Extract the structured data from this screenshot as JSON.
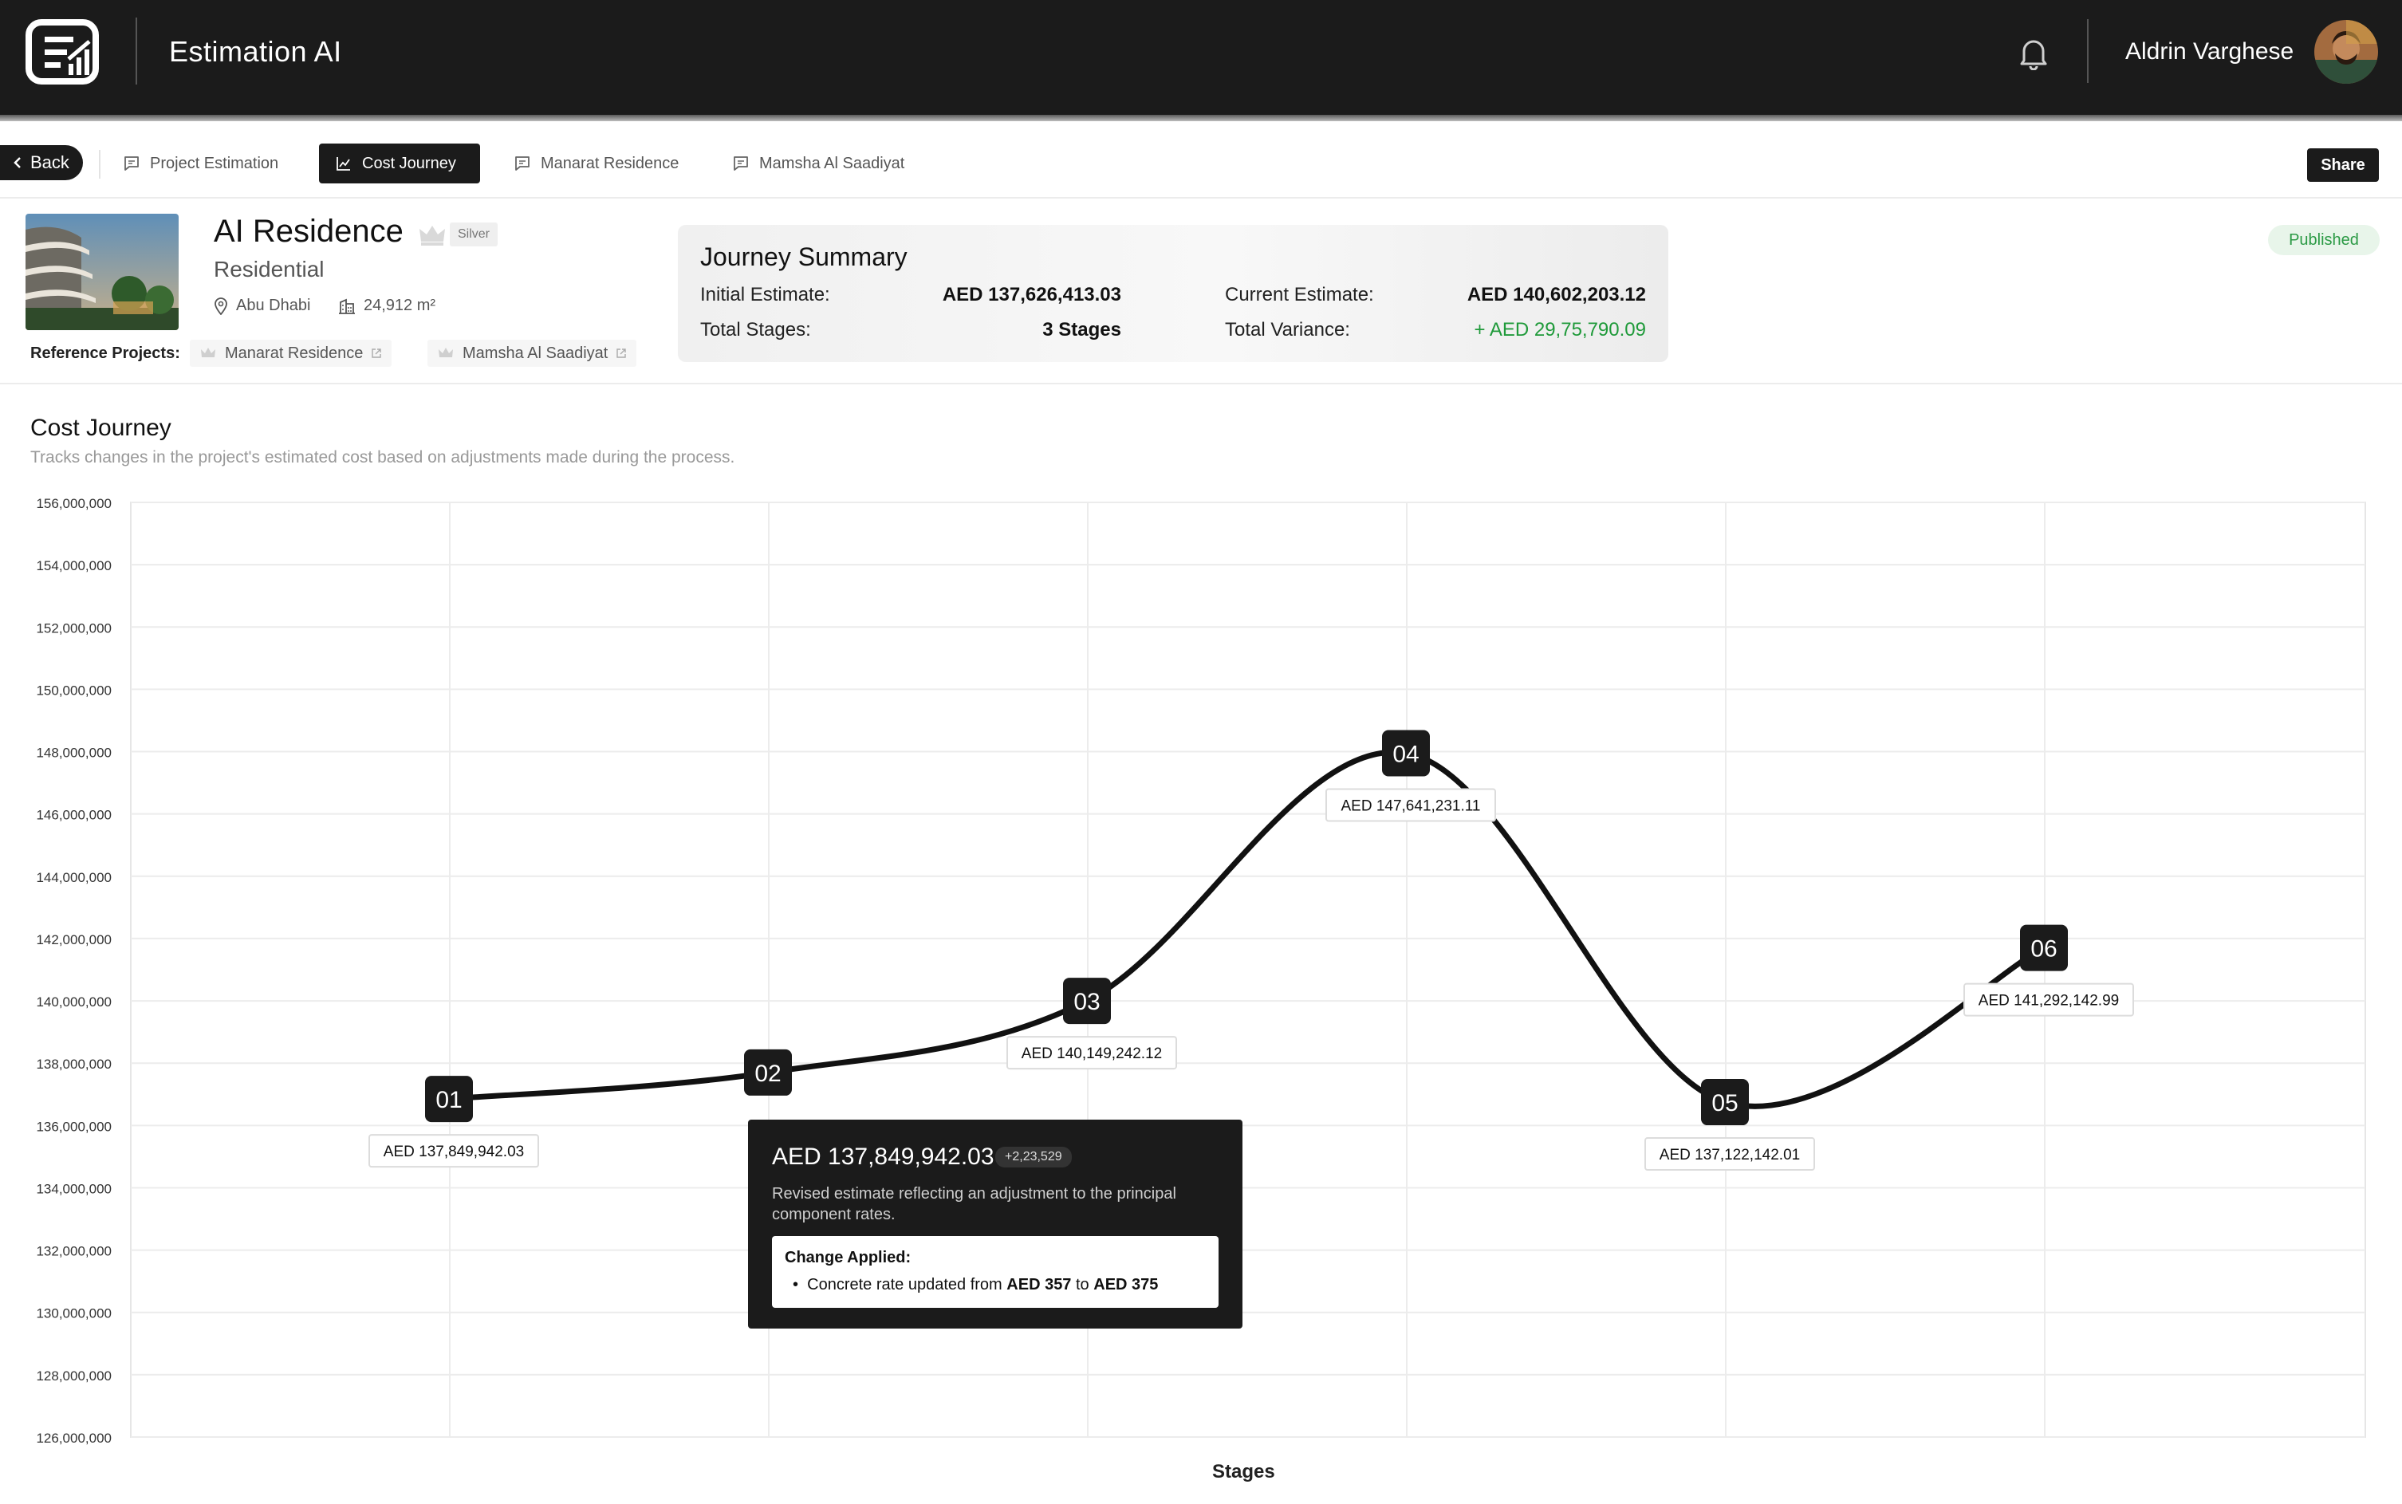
{
  "app": {
    "title": "Estimation AI",
    "logo_icon": "estimation-ai-logo",
    "user_name": "Aldrin Varghese"
  },
  "tabs": {
    "back_label": "Back",
    "items": [
      {
        "label": "Project Estimation",
        "icon": "message-icon",
        "active": false
      },
      {
        "label": "Cost Journey",
        "icon": "line-chart-icon",
        "active": true
      },
      {
        "label": "Manarat Residence",
        "icon": "message-icon",
        "active": false
      },
      {
        "label": "Mamsha Al Saadiyat",
        "icon": "message-icon",
        "active": false
      }
    ],
    "share_label": "Share"
  },
  "project": {
    "name": "AI Residence",
    "tier": "Silver",
    "type": "Residential",
    "location": "Abu Dhabi",
    "area": "24,912 m²",
    "reference_label": "Reference Projects:",
    "references": [
      "Manarat Residence",
      "Mamsha Al Saadiyat"
    ],
    "status": "Published"
  },
  "summary": {
    "title": "Journey Summary",
    "initial_label": "Initial Estimate:",
    "initial_value": "AED 137,626,413.03",
    "stages_label": "Total Stages:",
    "stages_value": "3 Stages",
    "current_label": "Current Estimate:",
    "current_value": "AED 140,602,203.12",
    "variance_label": "Total Variance:",
    "variance_value": "+ AED 29,75,790.09",
    "variance_color": "#1f9a3a"
  },
  "chart": {
    "title": "Cost Journey",
    "subtitle": "Tracks changes in the project's estimated cost based on adjustments made during the process.",
    "xlabel": "Stages"
  },
  "chart_data": {
    "type": "line",
    "xlabel": "Stages",
    "ylabel": "",
    "ylim": [
      126000000,
      156000000
    ],
    "y_ticks": [
      156000000,
      154000000,
      152000000,
      150000000,
      148000000,
      146000000,
      144000000,
      142000000,
      140000000,
      138000000,
      136000000,
      134000000,
      132000000,
      130000000,
      128000000,
      126000000
    ],
    "y_tick_labels": [
      "156,000,000",
      "154,000,000",
      "152,000,000",
      "150,000,000",
      "148,000,000",
      "146,000,000",
      "144,000,000",
      "142,000,000",
      "140,000,000",
      "138,000,000",
      "136,000,000",
      "134,000,000",
      "132,000,000",
      "130,000,000",
      "128,000,000",
      "126,000,000"
    ],
    "categories": [
      "01",
      "02",
      "03",
      "04",
      "05",
      "06"
    ],
    "values": [
      136850000,
      137700000,
      140000000,
      147950000,
      136750000,
      141700000
    ],
    "labels": [
      "AED 137,849,942.03",
      null,
      "AED 140,149,242.12",
      "AED 147,641,231.11",
      "AED 137,122,142.01",
      "AED 141,292,142.99"
    ],
    "grid": true
  },
  "tooltip": {
    "value": "AED 137,849,942.03",
    "delta": "+2,23,529",
    "description": "Revised estimate reflecting an adjustment to the principal component rates.",
    "change_title": "Change Applied:",
    "change_prefix": "Concrete rate updated from",
    "change_from": "AED 357",
    "change_to_word": "to",
    "change_to": "AED 375"
  }
}
